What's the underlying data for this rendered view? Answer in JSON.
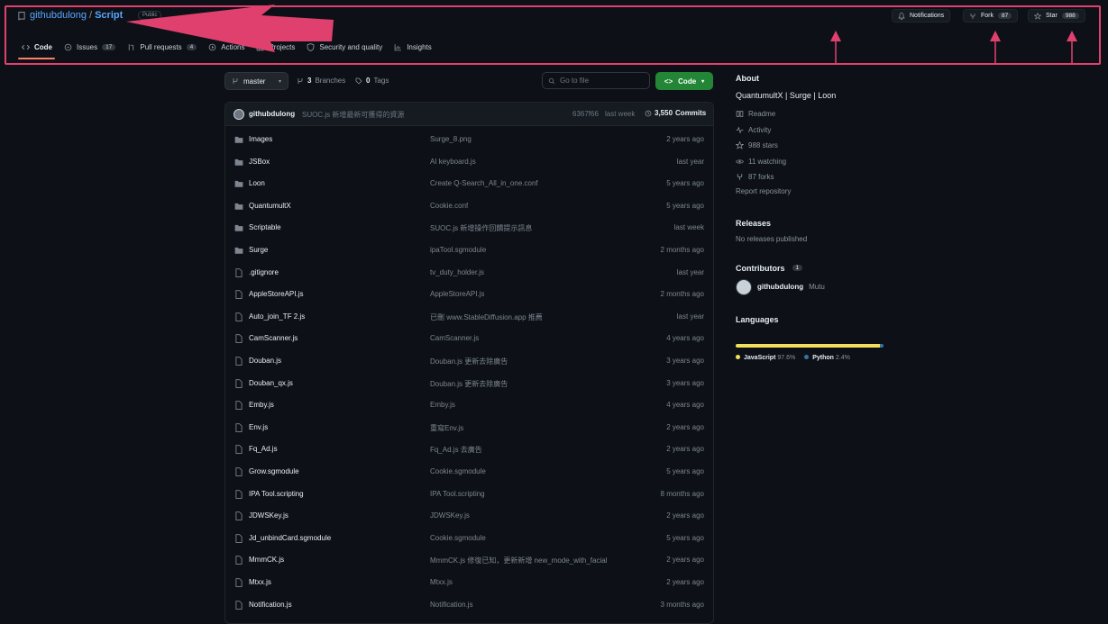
{
  "repo": {
    "owner": "githubdulong",
    "separator": "/",
    "name": "Script",
    "visibility": "Public"
  },
  "header_buttons": {
    "notifications": "Notifications",
    "fork_label": "Fork",
    "fork_count": "87",
    "star_label": "Star",
    "star_count": "988"
  },
  "tabs": [
    {
      "label": "Code",
      "icon": "code-icon"
    },
    {
      "label": "Issues",
      "count": "17",
      "icon": "issue-icon"
    },
    {
      "label": "Pull requests",
      "count": "4",
      "icon": "pull-request-icon"
    },
    {
      "label": "Actions",
      "icon": "play-icon"
    },
    {
      "label": "Projects",
      "icon": "table-icon"
    },
    {
      "label": "Security and quality",
      "icon": "shield-icon"
    },
    {
      "label": "Insights",
      "icon": "graph-icon"
    }
  ],
  "toolbar": {
    "branch": "master",
    "branches_count": "3",
    "branches_label": "Branches",
    "tags_count": "0",
    "tags_label": "Tags",
    "goto_placeholder": "Go to file",
    "code_label": "Code"
  },
  "latest_commit": {
    "author": "githubdulong",
    "message": "SUOC.js 新增最新可獲得的資源",
    "hash": "6367f66",
    "time": "last week",
    "commits_count": "3,550",
    "commits_label": "Commits"
  },
  "files": [
    {
      "type": "dir",
      "name": "Images",
      "message": "Surge_8.png",
      "date": "2 years ago"
    },
    {
      "type": "dir",
      "name": "JSBox",
      "message": "AI keyboard.js",
      "date": "last year"
    },
    {
      "type": "dir",
      "name": "Loon",
      "message": "Create Q-Search_All_in_one.conf",
      "date": "5 years ago"
    },
    {
      "type": "dir",
      "name": "QuantumultX",
      "message": "Cookie.conf",
      "date": "5 years ago"
    },
    {
      "type": "dir",
      "name": "Scriptable",
      "message": "SUOC.js 新增操作回饋提示訊息",
      "date": "last week"
    },
    {
      "type": "dir",
      "name": "Surge",
      "message": "ipaTool.sgmodule",
      "date": "2 months ago"
    },
    {
      "type": "file",
      "name": ".gitignore",
      "message": "tv_duty_holder.js",
      "date": "last year"
    },
    {
      "type": "file",
      "name": "AppleStoreAPI.js",
      "message": "AppleStoreAPI.js",
      "date": "2 months ago"
    },
    {
      "type": "file",
      "name": "Auto_join_TF 2.js",
      "message": "已刪 www.StableDiffusion.app 推薦",
      "date": "last year"
    },
    {
      "type": "file",
      "name": "CamScanner.js",
      "message": "CamScanner.js",
      "date": "4 years ago"
    },
    {
      "type": "file",
      "name": "Douban.js",
      "message": "Douban.js 更新去除廣告",
      "date": "3 years ago"
    },
    {
      "type": "file",
      "name": "Douban_qx.js",
      "message": "Douban.js 更新去除廣告",
      "date": "3 years ago"
    },
    {
      "type": "file",
      "name": "Emby.js",
      "message": "Emby.js",
      "date": "4 years ago"
    },
    {
      "type": "file",
      "name": "Env.js",
      "message": "重寫Env.js",
      "date": "2 years ago"
    },
    {
      "type": "file",
      "name": "Fq_Ad.js",
      "message": "Fq_Ad.js 去廣告",
      "date": "2 years ago"
    },
    {
      "type": "file",
      "name": "Grow.sgmodule",
      "message": "Cookie.sgmodule",
      "date": "5 years ago"
    },
    {
      "type": "file",
      "name": "IPA Tool.scripting",
      "message": "IPA Tool.scripting",
      "date": "8 months ago"
    },
    {
      "type": "file",
      "name": "JDWSKey.js",
      "message": "JDWSKey.js",
      "date": "2 years ago"
    },
    {
      "type": "file",
      "name": "Jd_unbindCard.sgmodule",
      "message": "Cookie.sgmodule",
      "date": "5 years ago"
    },
    {
      "type": "file",
      "name": "MmmCK.js",
      "message": "MmmCK.js 修復已知，更新新增 new_mode_with_facial",
      "date": "2 years ago"
    },
    {
      "type": "file",
      "name": "Mtxx.js",
      "message": "Mtxx.js",
      "date": "2 years ago"
    },
    {
      "type": "file",
      "name": "Notification.js",
      "message": "Notification.js",
      "date": "3 months ago"
    }
  ],
  "about": {
    "heading": "About",
    "description": "QuantumultX | Surge | Loon",
    "items": [
      {
        "icon": "book-icon",
        "label": "Readme"
      },
      {
        "icon": "pulse-icon",
        "label": "Activity"
      },
      {
        "icon": "star-icon",
        "label": "988 stars"
      },
      {
        "icon": "eye-icon",
        "label": "11 watching"
      },
      {
        "icon": "fork-icon",
        "label": "87 forks"
      }
    ],
    "report": "Report repository"
  },
  "releases": {
    "heading": "Releases",
    "text": "No releases published"
  },
  "contributors": {
    "heading": "Contributors",
    "count": "1",
    "name": "githubdulong",
    "alias": "Mutu"
  },
  "languages": {
    "heading": "Languages",
    "items": [
      {
        "name": "JavaScript",
        "percent": 97.6,
        "label": "97.6%",
        "color": "#f1e05a"
      },
      {
        "name": "Python",
        "percent": 2.4,
        "label": "2.4%",
        "color": "#3572a5"
      }
    ]
  },
  "colors": {
    "highlight": "#e0406e",
    "accent_tab": "#f78166",
    "code_button": "#238636",
    "link": "#58a6ff"
  }
}
